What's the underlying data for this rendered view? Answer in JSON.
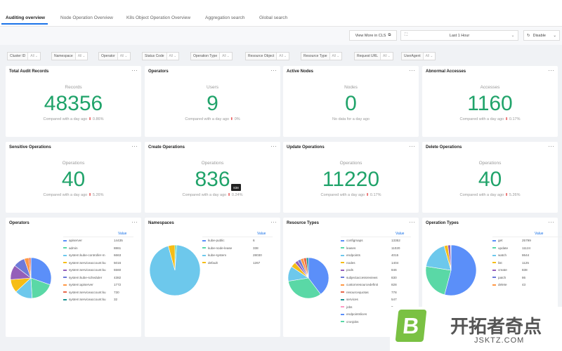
{
  "tabs": [
    "Auditing overview",
    "Node Operation Overview",
    "K8s Object Operation Overview",
    "Aggregation search",
    "Global search"
  ],
  "toolbar": {
    "view_more": "View More in CLS",
    "time_range": "Last 1 Hour",
    "refresh": "Disable"
  },
  "filters": [
    "Cluster ID",
    "Namespace",
    "Operator",
    "Status Code",
    "Operation Type",
    "Resource Object",
    "Resource Type",
    "Request URL",
    "UserAgent"
  ],
  "filter_placeholder": "All",
  "stat_cards": [
    {
      "title": "Total Audit Records",
      "label": "Records",
      "value": "48356",
      "compare": "Compared with a day ago",
      "change": "0.86%",
      "dir": "down"
    },
    {
      "title": "Operators",
      "label": "Users",
      "value": "9",
      "compare": "Compared with a day ago",
      "change": "0%",
      "dir": "up"
    },
    {
      "title": "Active Nodes",
      "label": "Nodes",
      "value": "0",
      "compare": "No data for a day ago",
      "change": "",
      "dir": ""
    },
    {
      "title": "Abnormal Accesses",
      "label": "Accesses",
      "value": "1160",
      "compare": "Compared with a day ago",
      "change": "0.17%",
      "dir": "down"
    },
    {
      "title": "Sensitive Operations",
      "label": "Operations",
      "value": "40",
      "compare": "Compared with a day ago",
      "change": "5.26%",
      "dir": "up"
    },
    {
      "title": "Create Operations",
      "label": "Operations",
      "value": "836",
      "compare": "Compared with a day ago",
      "change": "0.24%",
      "dir": "up"
    },
    {
      "title": "Update Operations",
      "label": "Operations",
      "value": "11220",
      "compare": "Compared with a day ago",
      "change": "0.17%",
      "dir": "up"
    },
    {
      "title": "Delete Operations",
      "label": "Operations",
      "value": "40",
      "compare": "Compared with a day ago",
      "change": "5.26%",
      "dir": "up"
    }
  ],
  "tooltip_text": "838",
  "charts": [
    {
      "title": "Operators",
      "value_header": "Value",
      "type": "pie",
      "items": [
        {
          "name": "apiserver",
          "value": 14435,
          "color": "#5b8ff9"
        },
        {
          "name": "admin",
          "value": 8861,
          "color": "#5ad8a6"
        },
        {
          "name": "system:kube-controller-m",
          "value": 6663,
          "color": "#6dc8ec"
        },
        {
          "name": "system:serviceaccount:ku",
          "value": 5016,
          "color": "#f6bd16"
        },
        {
          "name": "system:serviceaccount:ku",
          "value": 5560,
          "color": "#945fb9"
        },
        {
          "name": "system:kube-scheduler",
          "value": 4382,
          "color": "#6d7ad8"
        },
        {
          "name": "system:apiserver",
          "value": 1772,
          "color": "#ff9845"
        },
        {
          "name": "system:serviceaccount:ku",
          "value": 730,
          "color": "#e8684a"
        },
        {
          "name": "system:serviceaccount:ku",
          "value": 32,
          "color": "#1e9493"
        }
      ]
    },
    {
      "title": "Namespaces",
      "value_header": "Value",
      "type": "pie",
      "items": [
        {
          "name": "kube-public",
          "value": 6,
          "color": "#5b8ff9"
        },
        {
          "name": "kube-node-lease",
          "value": 338,
          "color": "#5ad8a6"
        },
        {
          "name": "kube-system",
          "value": 28030,
          "color": "#6dc8ec"
        },
        {
          "name": "default",
          "value": 1267,
          "color": "#f6bd16"
        }
      ]
    },
    {
      "title": "Resource Types",
      "value_header": "Value",
      "type": "pie",
      "items": [
        {
          "name": "configmaps",
          "value": 13352,
          "color": "#5b8ff9"
        },
        {
          "name": "leases",
          "value": 11020,
          "color": "#5ad8a6"
        },
        {
          "name": "endpoints",
          "value": 4015,
          "color": "#6dc8ec"
        },
        {
          "name": "nodes",
          "value": 1404,
          "color": "#f6bd16"
        },
        {
          "name": "pods",
          "value": 846,
          "color": "#945fb9"
        },
        {
          "name": "subjectaccessreviews",
          "value": 830,
          "color": "#6d7ad8"
        },
        {
          "name": "customresourcedefinit",
          "value": 828,
          "color": "#ff9845"
        },
        {
          "name": "resourcequotas",
          "value": 778,
          "color": "#e8684a"
        },
        {
          "name": "services",
          "value": 547,
          "color": "#1e9493"
        },
        {
          "name": "jobs",
          "value": 0,
          "color": "#ff99c3"
        },
        {
          "name": "endpointslices",
          "value": 0,
          "color": "#5b8ff9"
        },
        {
          "name": "cronjobs",
          "value": 0,
          "color": "#5ad8a6"
        }
      ]
    },
    {
      "title": "Operation Types",
      "value_header": "Value",
      "type": "pie",
      "items": [
        {
          "name": "get",
          "value": 25799,
          "color": "#5b8ff9"
        },
        {
          "name": "update",
          "value": 11124,
          "color": "#5ad8a6"
        },
        {
          "name": "watch",
          "value": 8644,
          "color": "#6dc8ec"
        },
        {
          "name": "list",
          "value": 1125,
          "color": "#f6bd16"
        },
        {
          "name": "create",
          "value": 838,
          "color": "#945fb9"
        },
        {
          "name": "patch",
          "value": 86,
          "color": "#6d7ad8"
        },
        {
          "name": "delete",
          "value": 43,
          "color": "#ff9845"
        }
      ]
    }
  ],
  "watermark": {
    "mark": "B",
    "text": "开拓者奇点",
    "url": "JSKTZ.COM"
  }
}
